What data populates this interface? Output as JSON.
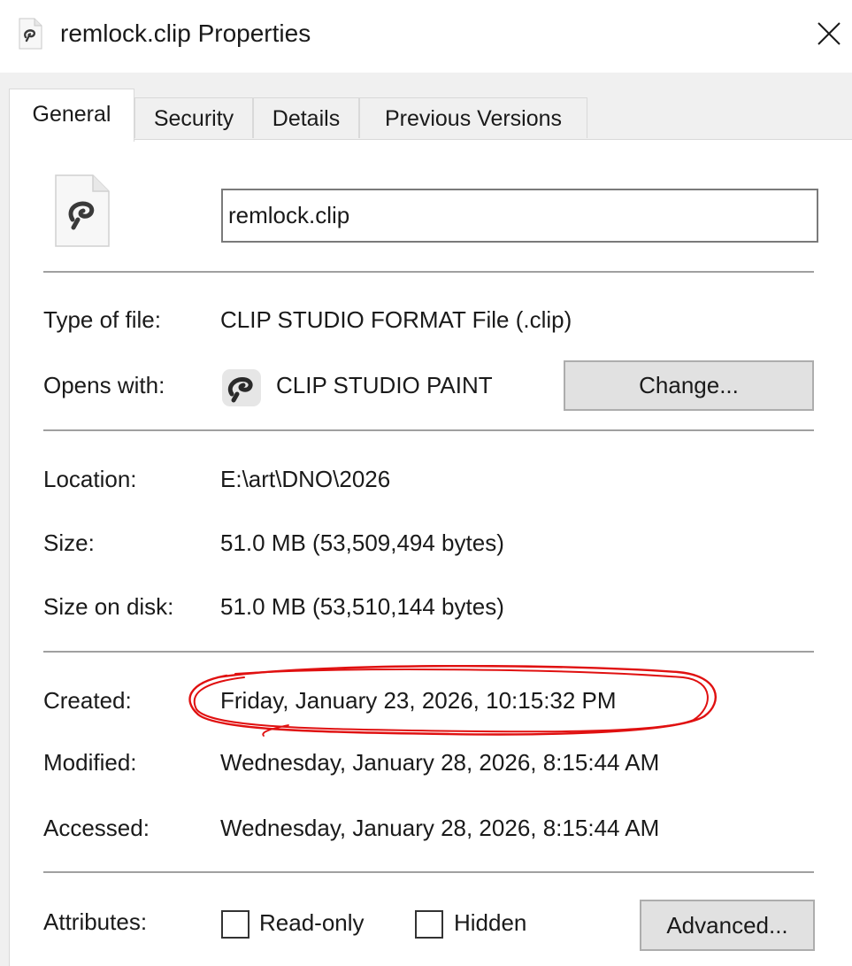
{
  "window": {
    "title": "remlock.clip Properties",
    "title_icon": "clip-studio-file-icon",
    "close_icon": "close-icon"
  },
  "tabs": [
    {
      "label": "General",
      "active": true
    },
    {
      "label": "Security",
      "active": false
    },
    {
      "label": "Details",
      "active": false
    },
    {
      "label": "Previous Versions",
      "active": false
    }
  ],
  "general": {
    "file_name": "remlock.clip",
    "type_label": "Type of file:",
    "type_value": "CLIP STUDIO FORMAT File (.clip)",
    "opens_label": "Opens with:",
    "opens_value": "CLIP STUDIO PAINT",
    "change_button": "Change...",
    "location_label": "Location:",
    "location_value": "E:\\art\\DNO\\2026",
    "size_label": "Size:",
    "size_value": "51.0 MB (53,509,494 bytes)",
    "size_on_disk_label": "Size on disk:",
    "size_on_disk_value": "51.0 MB (53,510,144 bytes)",
    "created_label": "Created:",
    "created_value": "Friday, January 23, 2026, 10:15:32 PM",
    "modified_label": "Modified:",
    "modified_value": "Wednesday, January 28, 2026, 8:15:44 AM",
    "accessed_label": "Accessed:",
    "accessed_value": "Wednesday, January 28, 2026, 8:15:44 AM",
    "attributes_label": "Attributes:",
    "readonly_label": "Read-only",
    "readonly_checked": false,
    "hidden_label": "Hidden",
    "hidden_checked": false,
    "advanced_button": "Advanced..."
  },
  "colors": {
    "annotation": "#e01010",
    "dialog_bg": "#f0f0f0",
    "panel_bg": "#ffffff"
  }
}
